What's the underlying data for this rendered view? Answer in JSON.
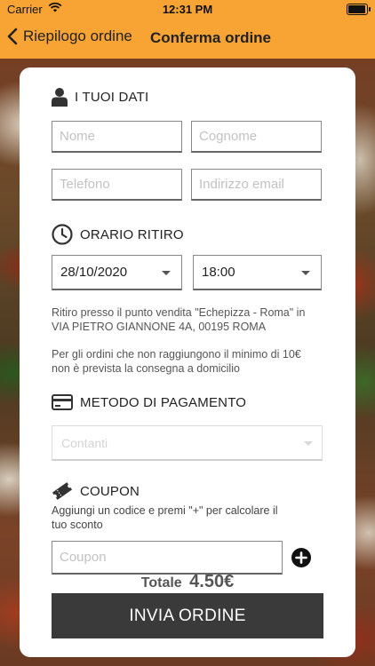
{
  "status_bar": {
    "carrier": "Carrier",
    "time": "12:31 PM"
  },
  "nav": {
    "back_label": "Riepilogo ordine",
    "title": "Conferma ordine"
  },
  "section_user": {
    "title": "I TUOI DATI",
    "icon": "user-icon",
    "fields": {
      "nome_placeholder": "Nome",
      "cognome_placeholder": "Cognome",
      "telefono_placeholder": "Telefono",
      "email_placeholder": "Indirizzo email"
    }
  },
  "section_pickup": {
    "title": "ORARIO RITIRO",
    "icon": "clock-icon",
    "date": "28/10/2020",
    "time": "18:00",
    "info_line1": "Ritiro presso il punto vendita \"Echepizza - Roma\" in",
    "info_line2": "VIA PIETRO GIANNONE 4A, 00195 ROMA",
    "delivery_line1": "Per gli ordini che non raggiungono il minimo di 10€",
    "delivery_line2": "non è prevista la consegna a domicilio"
  },
  "section_payment": {
    "title": "METODO DI PAGAMENTO",
    "icon": "credit-card-icon",
    "selected": "Contanti"
  },
  "section_coupon": {
    "title": "COUPON",
    "icon": "ticket-icon",
    "desc_line1": "Aggiungi un codice e premi \"+\" per calcolare il",
    "desc_line2": "tuo sconto",
    "placeholder": "Coupon"
  },
  "footer": {
    "total_label": "Totale",
    "total_value": "4.50€",
    "submit_label": "INVIA ORDINE"
  },
  "colors": {
    "accent": "#f7a435",
    "button": "#3a3a3a"
  }
}
